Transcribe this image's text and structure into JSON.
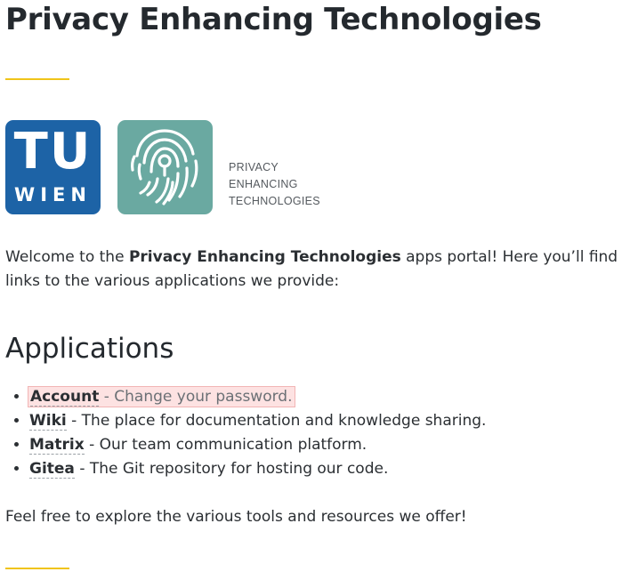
{
  "page": {
    "title": "Privacy Enhancing Technologies",
    "accent_color": "#f0c419"
  },
  "logos": {
    "tu": {
      "letters": "TU",
      "subtitle": "WIEN",
      "color": "#1d63a6"
    },
    "pet": {
      "icon": "fingerprint-icon",
      "color": "#6aa9a1",
      "lines": [
        "PRIVACY",
        "ENHANCING",
        "TECHNOLOGIES"
      ]
    }
  },
  "intro": {
    "prefix": "Welcome to the ",
    "bold": "Privacy Enhancing Technologies",
    "suffix": " apps portal! Here you’ll find links to the various applications we provide:"
  },
  "applications": {
    "heading": "Applications",
    "items": [
      {
        "name": "Account",
        "description": " - Change your password."
      },
      {
        "name": "Wiki",
        "description": " - The place for documentation and knowledge sharing."
      },
      {
        "name": "Matrix",
        "description": " - Our team communication platform."
      },
      {
        "name": "Gitea",
        "description": " - The Git repository for hosting our code."
      }
    ]
  },
  "outro": "Feel free to explore the various tools and resources we offer!"
}
